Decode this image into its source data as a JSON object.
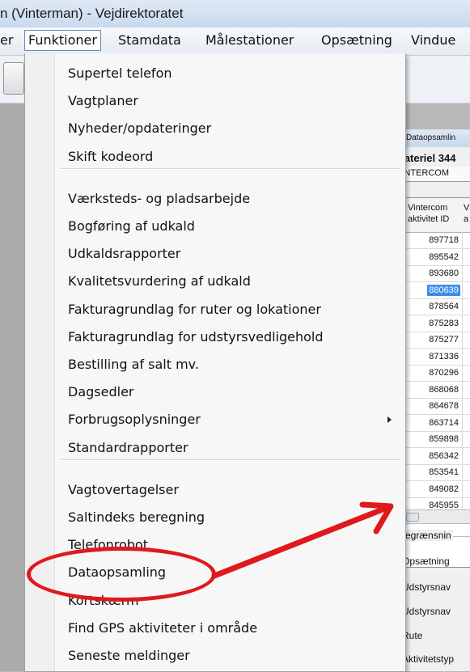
{
  "window": {
    "title": "n (Vinterman) - Vejdirektoratet"
  },
  "menubar": {
    "items": [
      "er",
      "Funktioner",
      "Stamdata",
      "Målestationer",
      "Opsætning",
      "Vindue"
    ],
    "active": "Funktioner"
  },
  "menu": {
    "groups": [
      [
        "Supertel telefon",
        "Vagtplaner",
        "Nyheder/opdateringer",
        "Skift kodeord"
      ],
      [
        "Værksteds- og pladsarbejde",
        "Bogføring af udkald",
        "Udkaldsrapporter",
        "Kvalitetsvurdering af udkald",
        "Fakturagrundlag for ruter og lokationer",
        "Fakturagrundlag for udstyrsvedligehold",
        "Bestilling af salt mv.",
        "Dagsedler",
        "Forbrugsoplysninger",
        "Standardrapporter"
      ],
      [
        "Vagtovertagelser",
        "Saltindeks beregning",
        "Telefonrobot",
        "Dataopsamling",
        "Kortskærm",
        "Find GPS aktiviteter i område",
        "Seneste meldinger"
      ]
    ],
    "submenu_item": "Forbrugsoplysninger",
    "highlighted_item": "Dataopsamling"
  },
  "child_window": {
    "title": "Dataopsamlin",
    "material": "Materiel 344",
    "tab": "VINTERCOM",
    "grid": {
      "header_line1": "Vintercom",
      "header_line2": "aktivitet ID",
      "header2_line1": "V",
      "header2_line2": "a",
      "rows": [
        "897718",
        "895542",
        "893680",
        "880639",
        "878564",
        "875283",
        "875277",
        "871336",
        "870296",
        "868068",
        "864678",
        "863714",
        "859898",
        "856342",
        "853541",
        "849082",
        "845955"
      ],
      "selected": "880639"
    },
    "filter": {
      "label": "Begrænsnin",
      "fields": [
        "Opsætning",
        "Udstyrsnav",
        "Udstyrsnav",
        "Rute",
        "Aktivitetstyp"
      ]
    }
  },
  "colors": {
    "annotation": "#e0191d",
    "selection": "#3c8ee8",
    "status_stripe": "#28c828"
  },
  "icons": {
    "toolbar": "refresh-icon",
    "window": "dataopsamling-icon",
    "submenu": "chevron-right-icon"
  }
}
